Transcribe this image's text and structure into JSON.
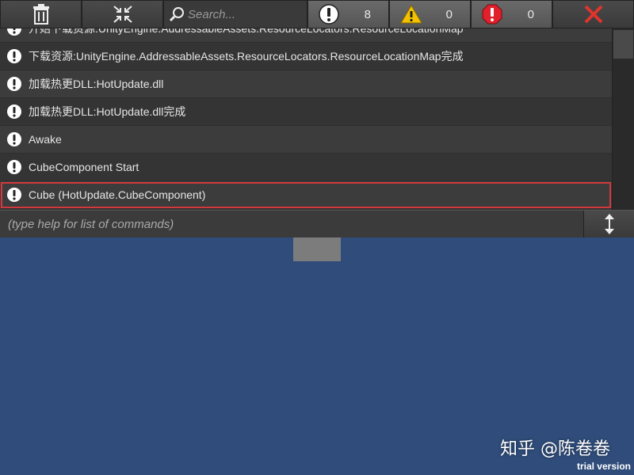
{
  "toolbar": {
    "clear_icon": "trash-icon",
    "collapse_icon": "collapse-arrows-icon",
    "search_placeholder": "Search...",
    "filters": [
      {
        "type": "info",
        "icon": "info-icon",
        "count": "8"
      },
      {
        "type": "warning",
        "icon": "warning-icon",
        "count": "0"
      },
      {
        "type": "error",
        "icon": "error-icon",
        "count": "0"
      }
    ],
    "close_icon": "close-icon"
  },
  "logs": [
    "开始下载资源:UnityEngine.AddressableAssets.ResourceLocators.ResourceLocationMap",
    "下载资源:UnityEngine.AddressableAssets.ResourceLocators.ResourceLocationMap完成",
    "加载热更DLL:HotUpdate.dll",
    "加载热更DLL:HotUpdate.dll完成",
    "Awake",
    "CubeComponent Start",
    "Cube (HotUpdate.CubeComponent)"
  ],
  "command": {
    "placeholder": "(type help for list of commands)",
    "resize_icon": "resize-vertical-icon"
  },
  "watermark": "知乎 @陈卷卷",
  "trial_label": "trial version",
  "colors": {
    "background": "#2f4c7a",
    "highlight": "#d2383c",
    "warning": "#f2c200",
    "error": "#e0202a",
    "close": "#e0342c"
  }
}
